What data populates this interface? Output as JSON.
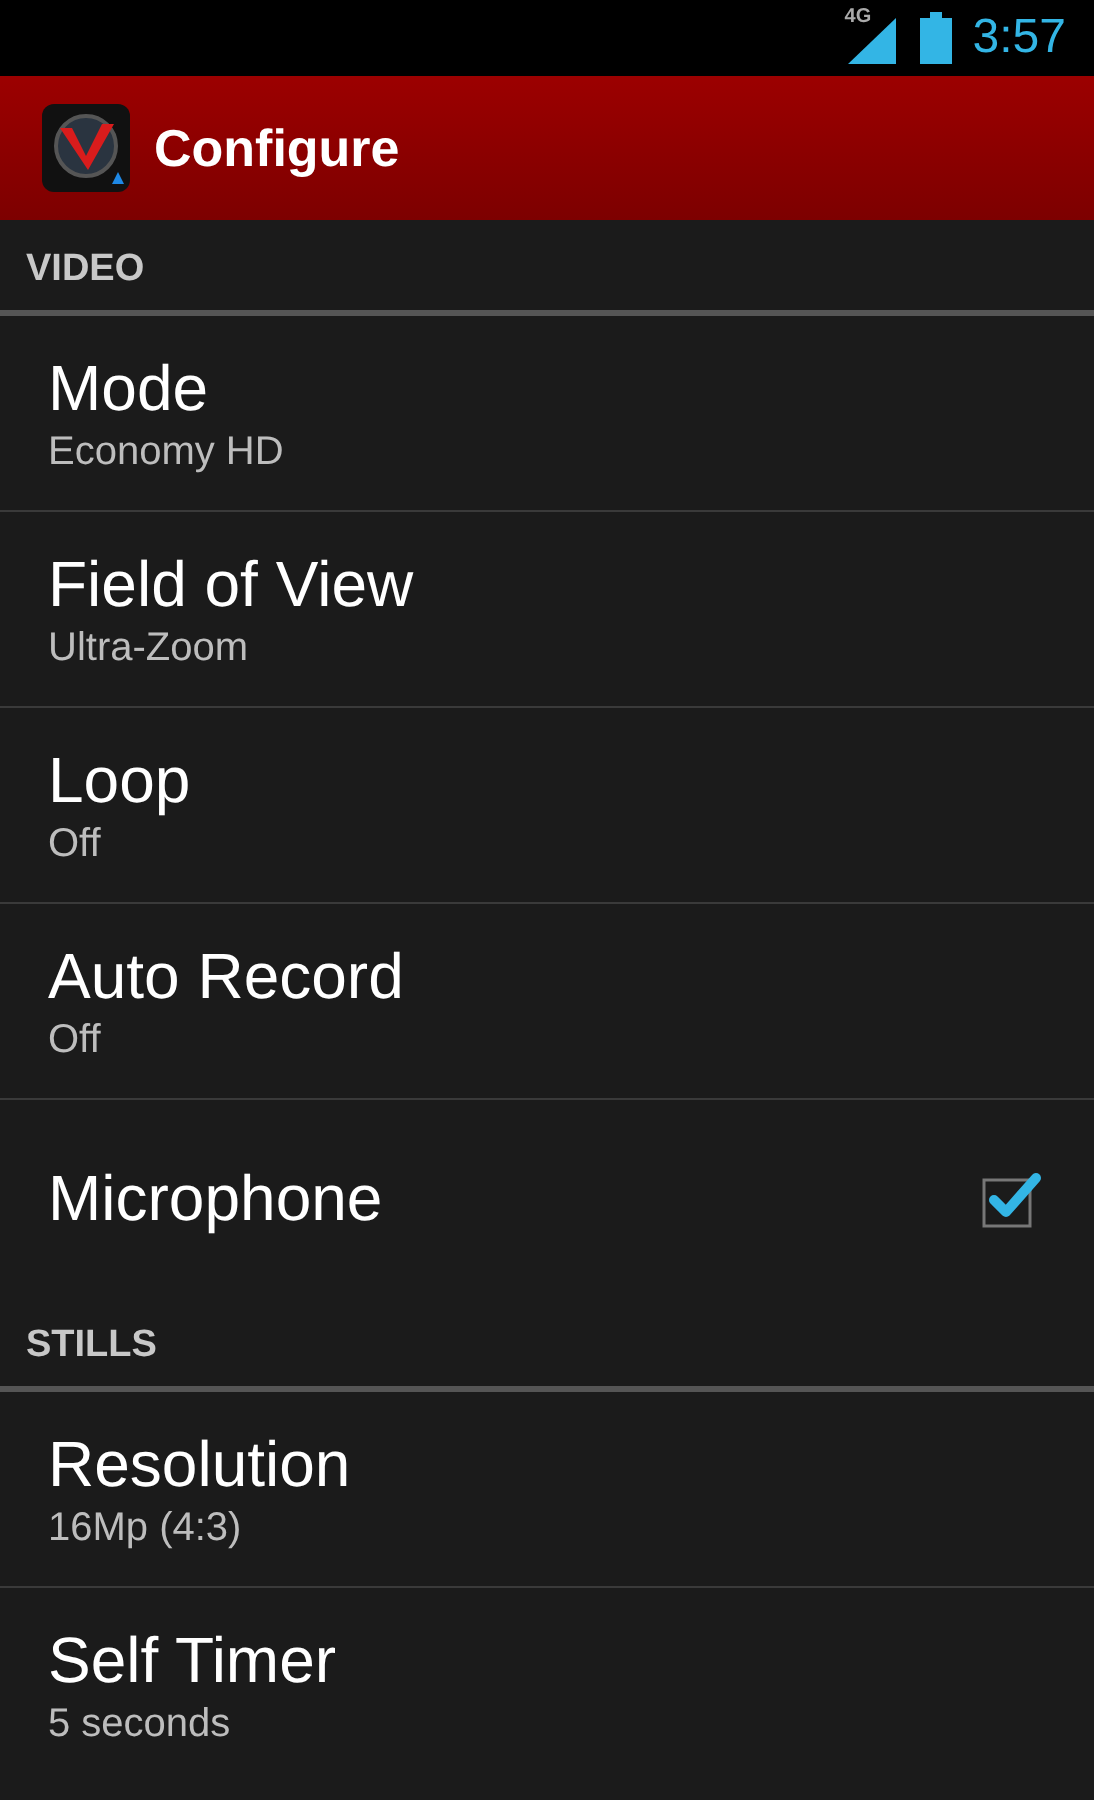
{
  "status_bar": {
    "network": "4G",
    "time": "3:57"
  },
  "app_bar": {
    "title": "Configure"
  },
  "sections": [
    {
      "header": "VIDEO",
      "items": [
        {
          "kind": "value",
          "title": "Mode",
          "summary": "Economy HD"
        },
        {
          "kind": "value",
          "title": "Field of View",
          "summary": "Ultra-Zoom"
        },
        {
          "kind": "value",
          "title": "Loop",
          "summary": "Off"
        },
        {
          "kind": "value",
          "title": "Auto Record",
          "summary": "Off"
        },
        {
          "kind": "checkbox",
          "title": "Microphone",
          "checked": true
        }
      ]
    },
    {
      "header": "STILLS",
      "items": [
        {
          "kind": "value",
          "title": "Resolution",
          "summary": "16Mp (4:3)"
        },
        {
          "kind": "value",
          "title": "Self Timer",
          "summary": "5 seconds"
        }
      ]
    }
  ]
}
